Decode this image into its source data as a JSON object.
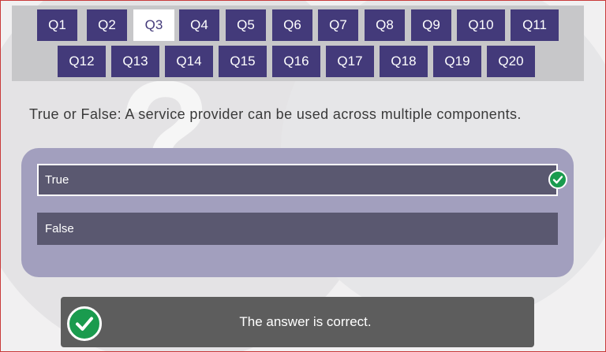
{
  "nav": {
    "row1": [
      "Q1",
      "Q2",
      "Q3",
      "Q4",
      "Q5",
      "Q6",
      "Q7",
      "Q8",
      "Q9",
      "Q10",
      "Q11"
    ],
    "row2": [
      "Q12",
      "Q13",
      "Q14",
      "Q15",
      "Q16",
      "Q17",
      "Q18",
      "Q19",
      "Q20"
    ],
    "active": "Q3"
  },
  "question": {
    "text": "True or False: A service provider can be used across multiple components."
  },
  "options": [
    {
      "label": "True",
      "selected": true,
      "correct": true
    },
    {
      "label": "False",
      "selected": false,
      "correct": false
    }
  ],
  "feedback": {
    "text": "The answer is correct.",
    "icon": "check-circle-icon"
  },
  "colors": {
    "nav_button": "#433a7a",
    "answers_panel": "#a29fbe",
    "option_bg": "#5a5870",
    "correct": "#1a9b4e",
    "feedback_bg": "#5d5d5d"
  }
}
